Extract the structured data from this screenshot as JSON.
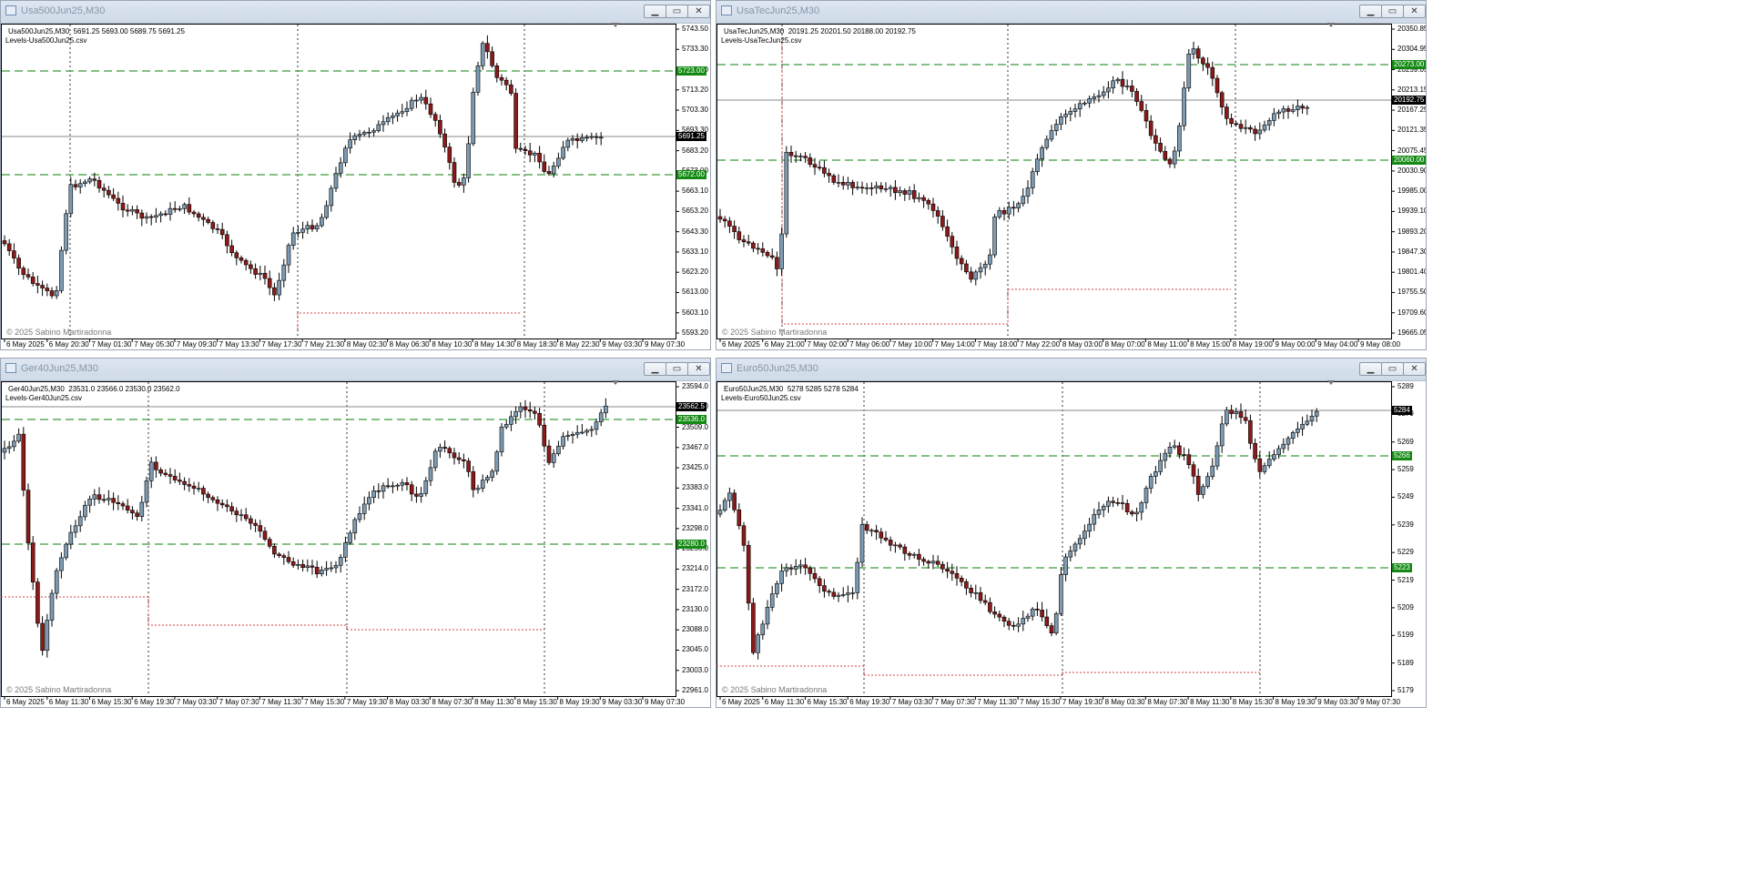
{
  "copyright": "© 2025 Sabino Martiradonna",
  "colors": {
    "bull": "#7d9bb3",
    "bear": "#8b1a1a",
    "level": "#3a9a3a",
    "levelTag": "#148a14",
    "priceTag": "#000000",
    "red_dots": "#d04040"
  },
  "windows": [
    {
      "title": "Usa500Jun25,M30",
      "info": "Usa500Jun25,M30  5691.25 5693.00 5689.75 5691.25",
      "levels_file": "Levels-Usa500Jun25.csv",
      "price_tag": "5691.25",
      "level_tags": [
        "5723.00",
        "5672.00"
      ],
      "y_labels": [
        "5743.50",
        "5733.30",
        "5723.20",
        "5713.20",
        "5703.30",
        "5693.30",
        "5683.20",
        "5673.00",
        "5663.10",
        "5653.20",
        "5643.30",
        "5633.10",
        "5623.20",
        "5613.00",
        "5603.10",
        "5593.20"
      ],
      "x_labels": [
        "6 May 2025",
        "6 May 20:30",
        "7 May 01:30",
        "7 May 05:30",
        "7 May 09:30",
        "7 May 13:30",
        "7 May 17:30",
        "7 May 21:30",
        "8 May 02:30",
        "8 May 06:30",
        "8 May 10:30",
        "8 May 14:30",
        "8 May 18:30",
        "8 May 22:30",
        "9 May 03:30",
        "9 May 07:30"
      ]
    },
    {
      "title": "UsaTecJun25,M30",
      "info": "UsaTecJun25,M30  20191.25 20201.50 20188.00 20192.75",
      "levels_file": "Levels-UsaTecJun25.csv",
      "price_tag": "20192.75",
      "level_tags": [
        "20273.00",
        "20060.00"
      ],
      "y_labels": [
        "20350.85",
        "20304.95",
        "20259.05",
        "20213.15",
        "20167.25",
        "20121.35",
        "20075.45",
        "20030.90",
        "19985.00",
        "19939.10",
        "19893.20",
        "19847.30",
        "19801.40",
        "19755.50",
        "19709.60",
        "19665.05"
      ],
      "x_labels": [
        "6 May 2025",
        "6 May 21:00",
        "7 May 02:00",
        "7 May 06:00",
        "7 May 10:00",
        "7 May 14:00",
        "7 May 18:00",
        "7 May 22:00",
        "8 May 03:00",
        "8 May 07:00",
        "8 May 11:00",
        "8 May 15:00",
        "8 May 19:00",
        "9 May 00:00",
        "9 May 04:00",
        "9 May 08:00"
      ]
    },
    {
      "title": "Ger40Jun25,M30",
      "info": "Ger40Jun25,M30  23531.0 23566.0 23530.0 23562.0",
      "levels_file": "Levels-Ger40Jun25.csv",
      "price_tag": "23562.5",
      "level_tags": [
        "23536.0",
        "23280.0"
      ],
      "y_labels": [
        "23594.0",
        "23551.0",
        "23509.0",
        "23467.0",
        "23425.0",
        "23383.0",
        "23341.0",
        "23298.0",
        "23256.0",
        "23214.0",
        "23172.0",
        "23130.0",
        "23088.0",
        "23045.0",
        "23003.0",
        "22961.0"
      ],
      "x_labels": [
        "6 May 2025",
        "6 May 11:30",
        "6 May 15:30",
        "6 May 19:30",
        "7 May 03:30",
        "7 May 07:30",
        "7 May 11:30",
        "7 May 15:30",
        "7 May 19:30",
        "8 May 03:30",
        "8 May 07:30",
        "8 May 11:30",
        "8 May 15:30",
        "8 May 19:30",
        "9 May 03:30",
        "9 May 07:30"
      ]
    },
    {
      "title": "Euro50Jun25,M30",
      "info": "Euro50Jun25,M30  5278 5285 5278 5284",
      "levels_file": "Levels-Euro50Jun25.csv",
      "price_tag": "5284",
      "level_tags": [
        "5266",
        "5223"
      ],
      "y_labels": [
        "5289",
        "5279",
        "5269",
        "5259",
        "5249",
        "5239",
        "5229",
        "5219",
        "5209",
        "5199",
        "5189",
        "5179"
      ],
      "x_labels": [
        "6 May 2025",
        "6 May 11:30",
        "6 May 15:30",
        "6 May 19:30",
        "7 May 03:30",
        "7 May 07:30",
        "7 May 11:30",
        "7 May 15:30",
        "7 May 19:30",
        "8 May 03:30",
        "8 May 07:30",
        "8 May 11:30",
        "8 May 15:30",
        "8 May 19:30",
        "9 May 03:30",
        "9 May 07:30"
      ]
    }
  ]
}
